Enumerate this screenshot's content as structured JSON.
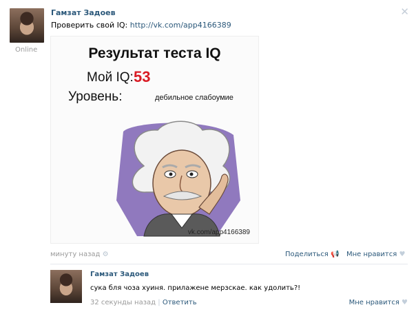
{
  "post": {
    "author": "Гамзат Задоев",
    "status": "Online",
    "text_prefix": "Проверить свой IQ:",
    "link": "http://vk.com/app4166389",
    "close_icon": "close-icon",
    "image": {
      "title": "Результат теста IQ",
      "iq_label": "Мой IQ:",
      "iq_value": "53",
      "level_label": "Уровень:",
      "level_value": "дебильное слабоумие",
      "watermark": "vk.com/app4166389",
      "accent_color": "#d91b24"
    },
    "timestamp": "минуту назад",
    "share_label": "Поделиться",
    "like_label": "Мне нравится"
  },
  "comment": {
    "author": "Гамзат Задоев",
    "text": "сука бля чоза хуиня. прилажене мерзскае. как удолить?!",
    "timestamp": "32 секунды назад",
    "separator": "|",
    "reply_label": "Ответить",
    "like_label": "Мне нравится"
  },
  "colors": {
    "link": "#2b587a",
    "muted": "#9a9a9a",
    "icon": "#c3cfdb"
  }
}
